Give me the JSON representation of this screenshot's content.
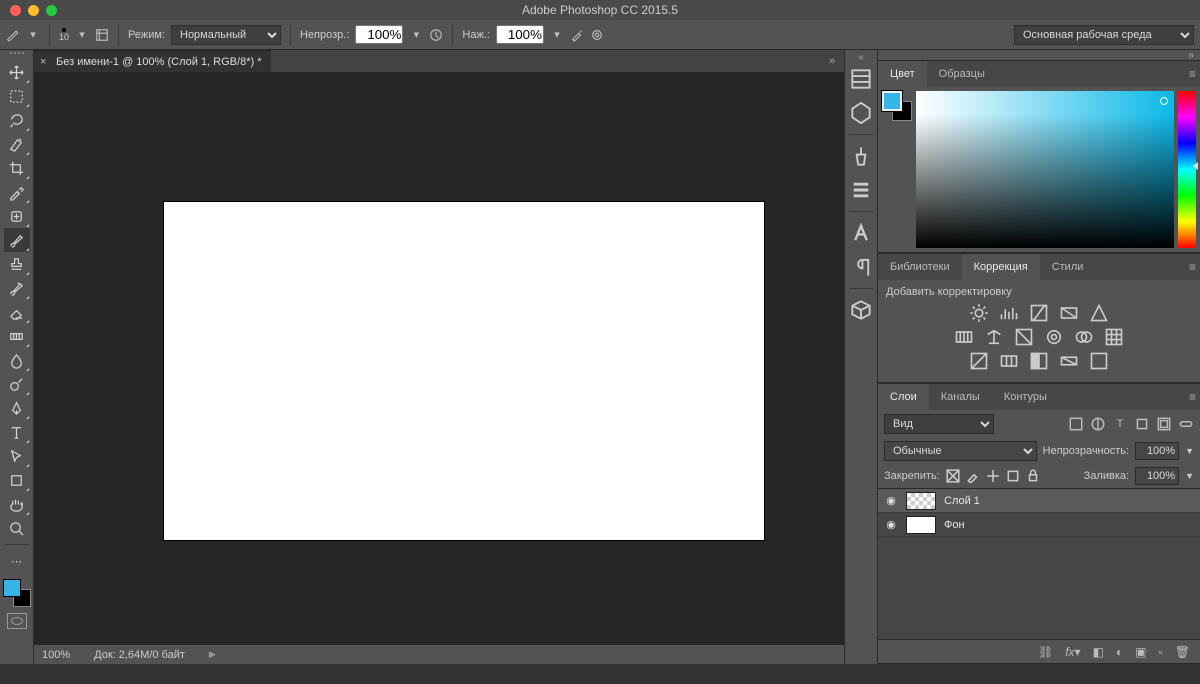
{
  "app": {
    "title": "Adobe Photoshop CC 2015.5"
  },
  "options": {
    "brush_size": "10",
    "mode_label": "Режим:",
    "mode_value": "Нормальный",
    "opacity_label": "Непрозр.:",
    "opacity_value": "100%",
    "flow_label": "Наж.:",
    "flow_value": "100%",
    "workspace": "Основная рабочая среда"
  },
  "tab": {
    "title": "Без имени-1 @ 100% (Слой 1, RGB/8*) *"
  },
  "status": {
    "zoom": "100%",
    "doc": "Док: 2,64M/0 байт"
  },
  "colors": {
    "fg": "#35b4e8",
    "bg": "#000000"
  },
  "panels": {
    "color": {
      "t1": "Цвет",
      "t2": "Образцы"
    },
    "adjust": {
      "t1": "Библиотеки",
      "t2": "Коррекция",
      "t3": "Стили",
      "add": "Добавить корректировку"
    },
    "layers": {
      "t1": "Слои",
      "t2": "Каналы",
      "t3": "Контуры",
      "kind": "Вид",
      "blend": "Обычные",
      "op_label": "Непрозрачность:",
      "op_value": "100%",
      "lock_label": "Закрепить:",
      "fill_label": "Заливка:",
      "fill_value": "100%",
      "items": [
        {
          "name": "Слой 1",
          "transparent": true,
          "selected": true
        },
        {
          "name": "Фон",
          "transparent": false,
          "selected": false
        }
      ]
    }
  }
}
